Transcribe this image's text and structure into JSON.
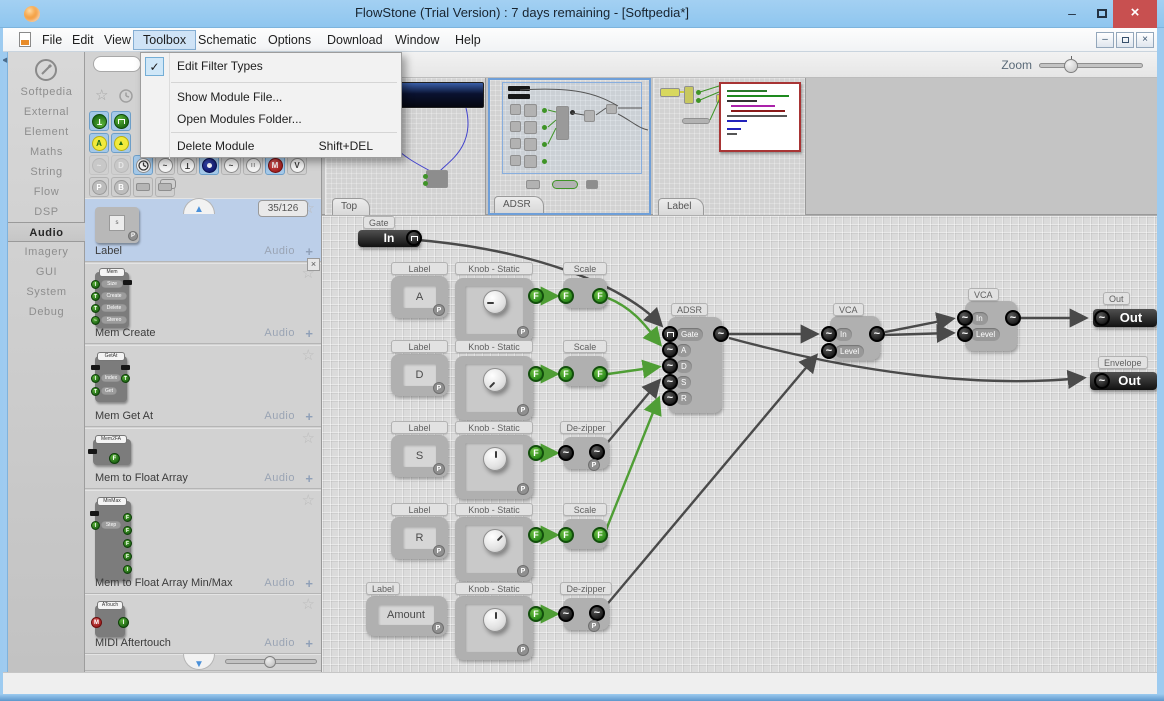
{
  "window": {
    "title": "FlowStone (Trial Version) : 7 days remaining - [Softpedia*]"
  },
  "icons": {
    "check": "✓",
    "minimize": "–",
    "close": "×",
    "star": "☆",
    "plus": "+",
    "up_arrow": "▲",
    "down_arrow": "▼",
    "left_arrow": "◀",
    "wave": "~",
    "play": "▶"
  },
  "colors": {
    "titlebar": "#8fc6ef",
    "close_button": "#c85050",
    "selection": "#bccfe9",
    "wire_green": "#4f9e35",
    "wire_dark": "#4a4a4a"
  },
  "menubar": {
    "items": [
      "File",
      "Edit",
      "View",
      "Toolbox",
      "Schematic",
      "Options",
      "Download",
      "Window",
      "Help"
    ],
    "active": "Toolbox"
  },
  "toolbox_menu": {
    "items": [
      {
        "label": "Edit Filter Types",
        "shortcut": "",
        "checked": true
      },
      {
        "label": "Show Module File...",
        "shortcut": "",
        "checked": false
      },
      {
        "label": "Open Modules Folder...",
        "shortcut": "",
        "checked": false
      },
      {
        "label": "Delete Module",
        "shortcut": "Shift+DEL",
        "checked": false
      }
    ]
  },
  "toolbar": {
    "zoom_label": "Zoom"
  },
  "sidebar": {
    "items": [
      "Softpedia",
      "External",
      "Element",
      "Maths",
      "String",
      "Flow",
      "DSP",
      "Audio",
      "Imagery",
      "GUI",
      "System",
      "Debug"
    ],
    "active": "Audio"
  },
  "palette": {
    "counter": "35/126",
    "filters": {
      "a": "A",
      "d": "D",
      "m": "M",
      "v": "V",
      "p": "P",
      "b": "B"
    },
    "items": [
      {
        "name": "Label",
        "category": "Audio",
        "thumb_title": "s",
        "ports": []
      },
      {
        "name": "Mem Create",
        "category": "Audio",
        "thumb_title": "Mem",
        "ports": [
          "Size",
          "Create",
          "Delete",
          "Stereo"
        ]
      },
      {
        "name": "Mem Get At",
        "category": "Audio",
        "thumb_title": "GetAt",
        "ports": [
          "Index",
          "Get"
        ]
      },
      {
        "name": "Mem to Float Array",
        "category": "Audio",
        "thumb_title": "Mem2FA",
        "ports": [
          "F"
        ]
      },
      {
        "name": "Mem to Float Array Min/Max",
        "category": "Audio",
        "thumb_title": "MinMax",
        "ports": [
          "Step",
          "F",
          "F",
          "F",
          "F",
          "I"
        ]
      },
      {
        "name": "MIDI Aftertouch",
        "category": "Audio",
        "thumb_title": "ATouch",
        "ports": [
          "M",
          "I"
        ]
      }
    ]
  },
  "previews": {
    "tabs": [
      "Top",
      "ADSR",
      "Label"
    ],
    "active": "ADSR"
  },
  "canvas": {
    "f": "F",
    "p": "P",
    "wave": "~",
    "gate": {
      "caption": "Gate",
      "label": "In"
    },
    "rows": [
      {
        "caption": "Label",
        "letter": "A",
        "knob_caption": "Knob - Static",
        "proc_caption": "Scale"
      },
      {
        "caption": "Label",
        "letter": "D",
        "knob_caption": "Knob - Static",
        "proc_caption": "Scale"
      },
      {
        "caption": "Label",
        "letter": "S",
        "knob_caption": "Knob - Static",
        "proc_caption": "De-zipper"
      },
      {
        "caption": "Label",
        "letter": "R",
        "knob_caption": "Knob - Static",
        "proc_caption": "Scale"
      },
      {
        "caption": "Label",
        "letter": "Amount",
        "knob_caption": "Knob - Static",
        "proc_caption": "De-zipper"
      }
    ],
    "adsr": {
      "caption": "ADSR",
      "ports": [
        "Gate",
        "A",
        "D",
        "S",
        "R"
      ]
    },
    "vca1": {
      "caption": "VCA",
      "ports": [
        "In",
        "Level"
      ]
    },
    "vca2": {
      "caption": "VCA",
      "ports": [
        "In",
        "Level"
      ]
    },
    "out": {
      "caption": "Out",
      "label": "Out"
    },
    "envelope": {
      "caption": "Envelope",
      "label": "Out"
    }
  }
}
